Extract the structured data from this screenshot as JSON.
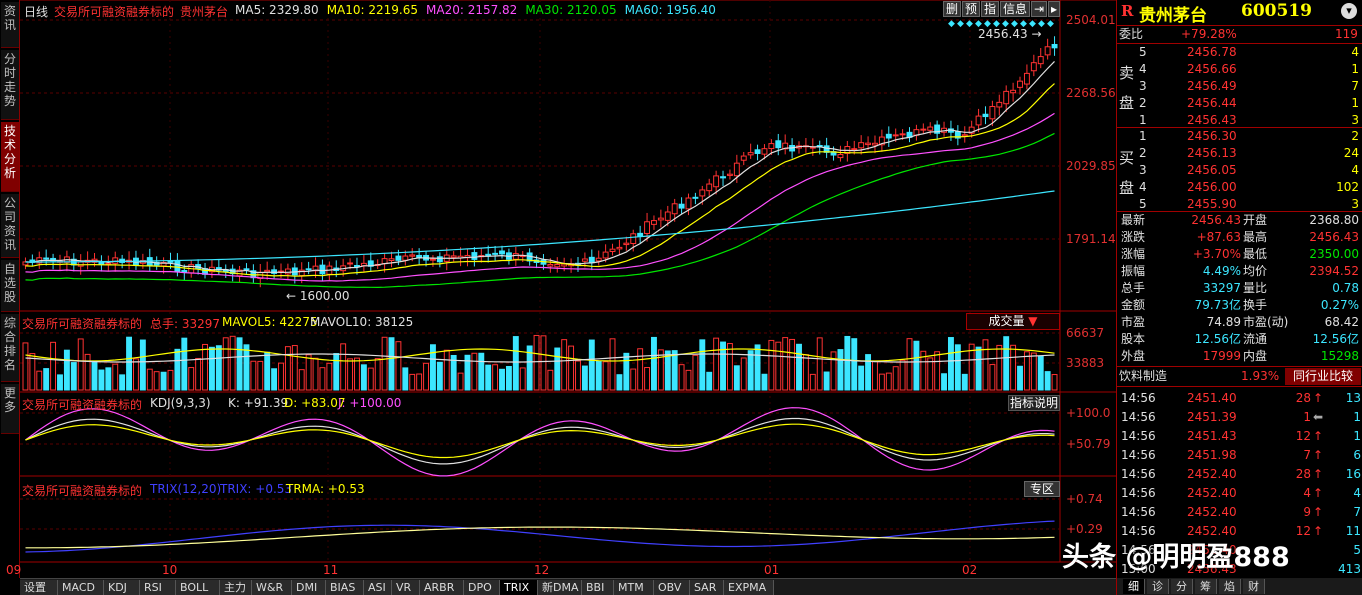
{
  "left_tabs": [
    "资讯",
    "分时走势",
    "技术分析",
    "公司资讯",
    "自选股",
    "综合排名",
    "更多"
  ],
  "main": {
    "period": "日线",
    "indicator_title": "交易所可融资融券标的",
    "stock_name": "贵州茅台",
    "ma": [
      {
        "label": "MA5: 2329.80",
        "color": "#e0e0e0"
      },
      {
        "label": "MA10: 2219.65",
        "color": "#ffff00"
      },
      {
        "label": "MA20: 2157.82",
        "color": "#ff50ff"
      },
      {
        "label": "MA30: 2120.05",
        "color": "#00e600"
      },
      {
        "label": "MA60: 1956.40",
        "color": "#3ce6ff"
      }
    ],
    "toolbar": [
      "删",
      "预",
      "指",
      "信息",
      "⇥",
      "▸"
    ],
    "y_ticks": [
      "2504.01",
      "2268.56",
      "2029.85",
      "1791.14"
    ],
    "high_annotation": "2456.43",
    "low_annotation": "1600.00"
  },
  "volume": {
    "title": "交易所可融资融券标的",
    "total_label": "总手: 33297",
    "mavol5": "MAVOL5: 42275",
    "mavol10": "MAVOL10: 38125",
    "button": "成交量",
    "y_ticks": [
      "66637",
      "33883"
    ]
  },
  "kdj": {
    "title": "交易所可融资融券标的",
    "name": "KDJ(9,3,3)",
    "k": "K: +91.39",
    "d": "D: +83.07",
    "j": "J: +100.00",
    "button": "指标说明",
    "y_ticks": [
      "+100.0",
      "+50.79"
    ]
  },
  "trix": {
    "title": "交易所可融资融券标的",
    "name": "TRIX(12,20)",
    "trix": "TRIX: +0.53",
    "trma": "TRMA: +0.53",
    "button": "专区",
    "y_ticks": [
      "+0.74",
      "+0.29"
    ]
  },
  "x_axis": [
    "09",
    "10",
    "11",
    "12",
    "01",
    "02"
  ],
  "bottom_tabs": [
    "设置",
    "MACD",
    "KDJ",
    "RSI",
    "BOLL",
    "主力",
    "W&R",
    "DMI",
    "BIAS",
    "ASI",
    "VR",
    "ARBR",
    "DPO",
    "TRIX",
    "新DMA",
    "BBI",
    "MTM",
    "OBV",
    "SAR",
    "EXPMA"
  ],
  "active_bottom_tab": "TRIX",
  "quote": {
    "logo": "R",
    "name": "贵州茅台",
    "code": "600519",
    "weibi_label": "委比",
    "weibi_value": "+79.28%",
    "weicha": "119",
    "sell_label": [
      "卖",
      "盘"
    ],
    "buy_label": [
      "买",
      "盘"
    ],
    "sells": [
      {
        "level": "5",
        "price": "2456.78",
        "vol": "4"
      },
      {
        "level": "4",
        "price": "2456.66",
        "vol": "1"
      },
      {
        "level": "3",
        "price": "2456.49",
        "vol": "7"
      },
      {
        "level": "2",
        "price": "2456.44",
        "vol": "1"
      },
      {
        "level": "1",
        "price": "2456.43",
        "vol": "3"
      }
    ],
    "buys": [
      {
        "level": "1",
        "price": "2456.30",
        "vol": "2"
      },
      {
        "level": "2",
        "price": "2456.13",
        "vol": "24"
      },
      {
        "level": "3",
        "price": "2456.05",
        "vol": "4"
      },
      {
        "level": "4",
        "price": "2456.00",
        "vol": "102"
      },
      {
        "level": "5",
        "price": "2455.90",
        "vol": "3"
      }
    ],
    "stats": [
      {
        "l1": "最新",
        "v1": "2456.43",
        "c1": "#ff3232",
        "l2": "开盘",
        "v2": "2368.80",
        "c2": "#e0e0e0"
      },
      {
        "l1": "涨跌",
        "v1": "+87.63",
        "c1": "#ff3232",
        "l2": "最高",
        "v2": "2456.43",
        "c2": "#ff3232"
      },
      {
        "l1": "涨幅",
        "v1": "+3.70%",
        "c1": "#ff3232",
        "l2": "最低",
        "v2": "2350.00",
        "c2": "#00e600"
      },
      {
        "l1": "振幅",
        "v1": "4.49%",
        "c1": "#3ce6ff",
        "l2": "均价",
        "v2": "2394.52",
        "c2": "#ff3232"
      },
      {
        "l1": "总手",
        "v1": "33297",
        "c1": "#3ce6ff",
        "l2": "量比",
        "v2": "0.78",
        "c2": "#3ce6ff"
      },
      {
        "l1": "金额",
        "v1": "79.73亿",
        "c1": "#3ce6ff",
        "l2": "换手",
        "v2": "0.27%",
        "c2": "#3ce6ff"
      },
      {
        "l1": "市盈",
        "v1": "74.89",
        "c1": "#e0e0e0",
        "l2": "市盈(动)",
        "v2": "68.42",
        "c2": "#e0e0e0"
      },
      {
        "l1": "股本",
        "v1": "12.56亿",
        "c1": "#3ce6ff",
        "l2": "流通",
        "v2": "12.56亿",
        "c2": "#3ce6ff"
      },
      {
        "l1": "外盘",
        "v1": "17999",
        "c1": "#ff3232",
        "l2": "内盘",
        "v2": "15298",
        "c2": "#00e600"
      }
    ],
    "industry": "饮料制造",
    "industry_change": "1.93%",
    "industry_button": "同行业比较",
    "ticks": [
      {
        "time": "14:56",
        "price": "2451.40",
        "vol": "28",
        "dir": "up",
        "n": "13"
      },
      {
        "time": "14:56",
        "price": "2451.39",
        "vol": "1",
        "dir": "left",
        "n": "1"
      },
      {
        "time": "14:56",
        "price": "2451.43",
        "vol": "12",
        "dir": "up",
        "n": "1"
      },
      {
        "time": "14:56",
        "price": "2451.98",
        "vol": "7",
        "dir": "up",
        "n": "6"
      },
      {
        "time": "14:56",
        "price": "2452.40",
        "vol": "28",
        "dir": "up",
        "n": "16"
      },
      {
        "time": "14:56",
        "price": "2452.40",
        "vol": "4",
        "dir": "up",
        "n": "4"
      },
      {
        "time": "14:56",
        "price": "2452.40",
        "vol": "9",
        "dir": "up",
        "n": "7"
      },
      {
        "time": "14:56",
        "price": "2452.40",
        "vol": "12",
        "dir": "up",
        "n": "11"
      },
      {
        "time": "14:56",
        "price": "2452.40",
        "vol": "",
        "dir": "",
        "n": "5"
      },
      {
        "time": "15:00",
        "price": "2456.43",
        "vol": "",
        "dir": "",
        "n": "413"
      }
    ],
    "bottom_tabs": [
      "细",
      "诊",
      "分",
      "筹",
      "焰",
      "财"
    ]
  },
  "watermark": "头条 @明明盈888",
  "colors": {
    "up": "#ff3232",
    "down": "#3ce6ff",
    "grid": "#8b0000",
    "bg": "#000000"
  }
}
